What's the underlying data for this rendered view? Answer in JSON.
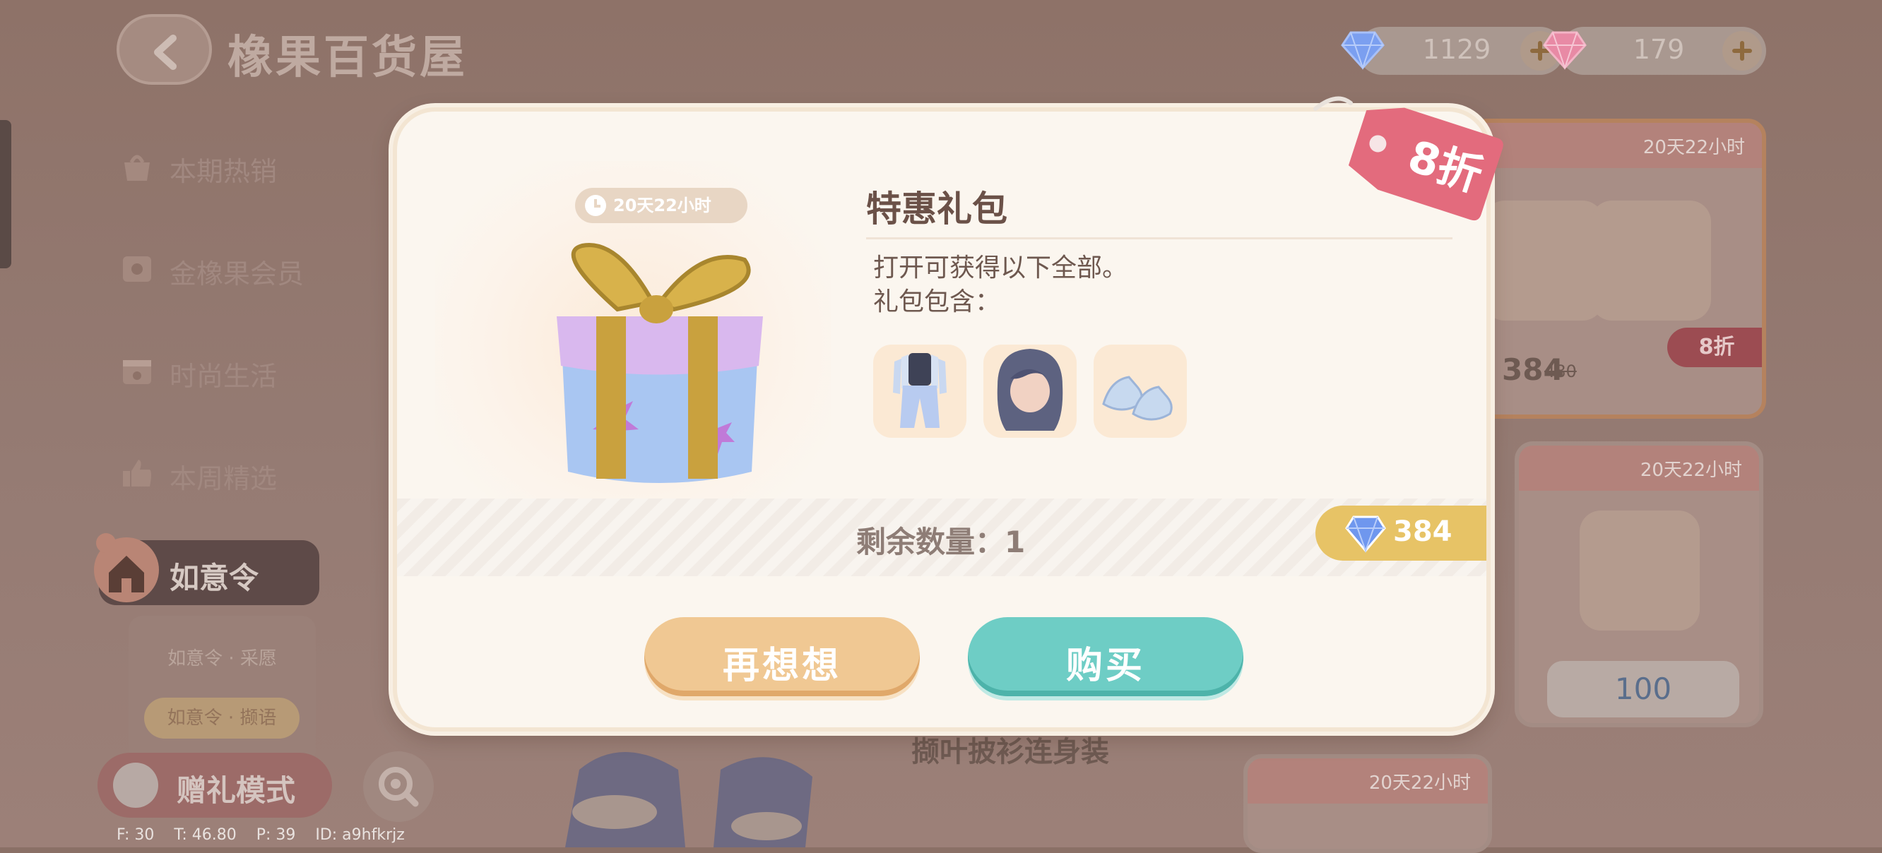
{
  "header": {
    "title": "橡果百货屋"
  },
  "currency": [
    {
      "name": "blue-gem",
      "value": "1129",
      "color": "#7b9ff0"
    },
    {
      "name": "pink-gem",
      "value": "179",
      "color": "#f08aa7"
    }
  ],
  "sidebar": {
    "items": [
      {
        "label": "本期热销",
        "icon": "fire-bag-icon"
      },
      {
        "label": "金橡果会员",
        "icon": "member-card-icon"
      },
      {
        "label": "时尚生活",
        "icon": "calendar-icon"
      },
      {
        "label": "本周精选",
        "icon": "thumbs-up-icon"
      }
    ],
    "active": {
      "label": "如意令",
      "icon": "house-badge-icon"
    },
    "sub": {
      "item1": "如意令 · 采愿",
      "item2": "如意令 · 撷语"
    }
  },
  "bottom": {
    "gift_mode": "赠礼模式",
    "debug": "F: 30    T: 46.80    P: 39    ID: a9hfkrjz"
  },
  "background_shop": {
    "timer": "20天22小时",
    "card_a": {
      "price": "384",
      "old_price": "480",
      "badge": "8折"
    },
    "card_b": {
      "price": "100"
    },
    "product_name": "撷叶披衫连身装"
  },
  "dialog": {
    "timer": "20天22小时",
    "discount": "8折",
    "title": "特惠礼包",
    "desc_line1": "打开可获得以下全部。",
    "desc_line2": "礼包包含：",
    "contents": [
      {
        "name": "outfit"
      },
      {
        "name": "hairstyle"
      },
      {
        "name": "shoes"
      }
    ],
    "remaining": "剩余数量：1",
    "price": "384",
    "cancel_label": "再想想",
    "buy_label": "购买"
  },
  "colors": {
    "accent_teal": "#6ecdc5",
    "accent_peach": "#f0c893",
    "price_gold": "#e7c366",
    "discount_pink": "#e36b7d"
  }
}
